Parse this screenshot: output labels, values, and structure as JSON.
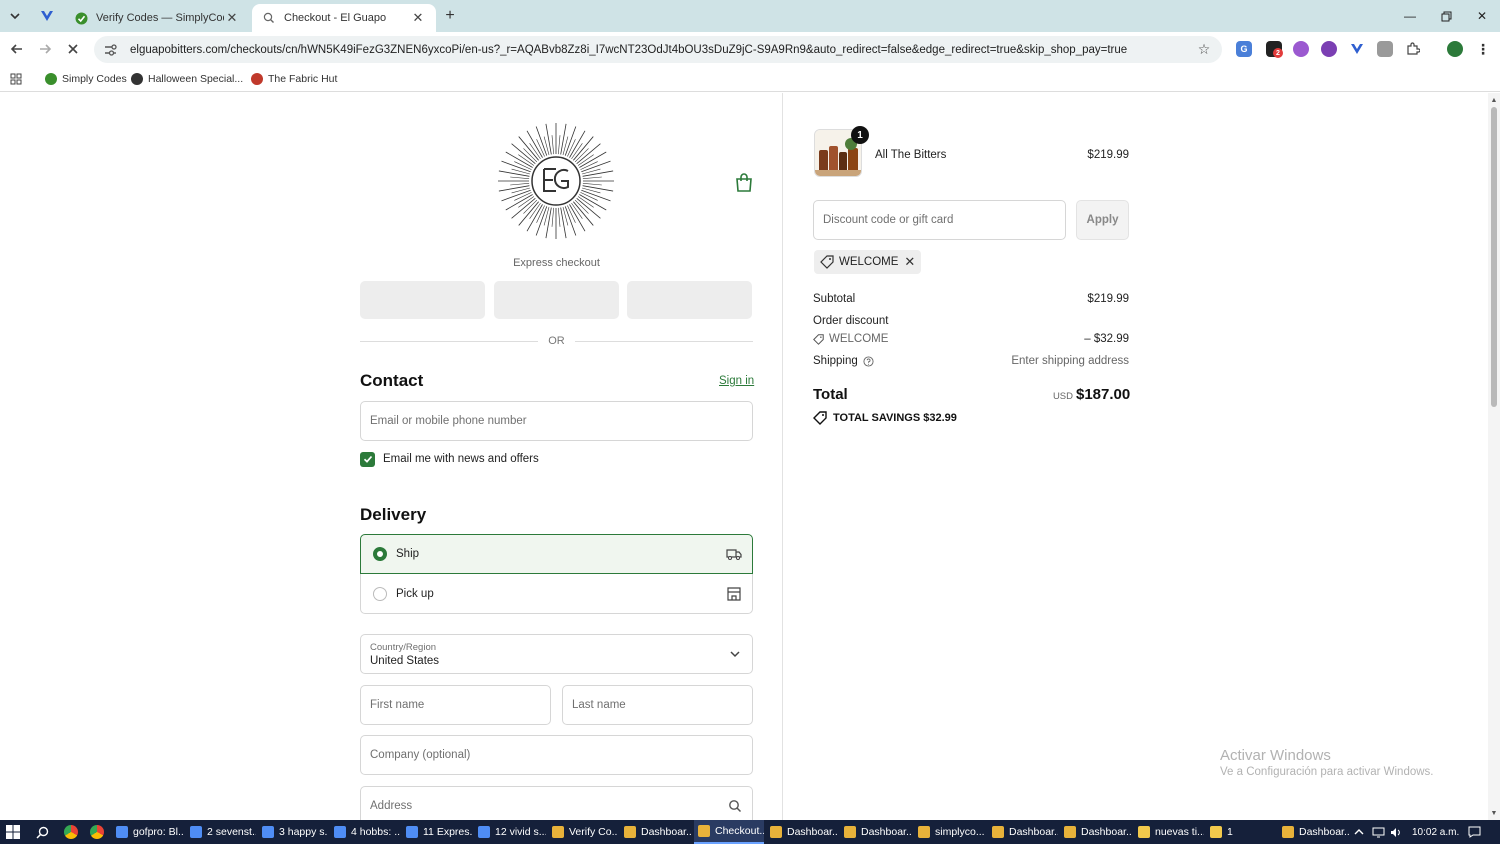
{
  "browser": {
    "tabs": [
      {
        "title": "Verify Codes — SimplyCodes",
        "active": false,
        "icon": "simplycodes-icon"
      },
      {
        "title": "Checkout - El Guapo",
        "active": true,
        "icon": "shop-icon"
      }
    ],
    "url": "elguapobitters.com/checkouts/cn/hWN5K49iFezG3ZNEN6yxcoPi/en-us?_r=AQABvb8Zz8i_I7wcNT23OdJt4bOU3sDuZ9jC-S9A9Rn9&auto_redirect=false&edge_redirect=true&skip_shop_pay=true",
    "bookmarks": [
      "Simply Codes",
      "Halloween Special...",
      "The Fabric Hut"
    ],
    "extension_badge": "2"
  },
  "checkout": {
    "express_label": "Express checkout",
    "or_label": "OR",
    "contact": {
      "heading": "Contact",
      "sign_in": "Sign in",
      "email_placeholder": "Email or mobile phone number",
      "newsletter_label": "Email me with news and offers",
      "newsletter_checked": true
    },
    "delivery": {
      "heading": "Delivery",
      "options": [
        {
          "label": "Ship",
          "selected": true,
          "icon": "truck-icon"
        },
        {
          "label": "Pick up",
          "selected": false,
          "icon": "store-icon"
        }
      ],
      "country_label": "Country/Region",
      "country_value": "United States",
      "first_name_placeholder": "First name",
      "last_name_placeholder": "Last name",
      "company_placeholder": "Company (optional)",
      "address_placeholder": "Address"
    }
  },
  "summary": {
    "product": {
      "name": "All The Bitters",
      "price": "$219.99",
      "quantity": "1"
    },
    "discount_placeholder": "Discount code or gift card",
    "apply_label": "Apply",
    "applied_code": "WELCOME",
    "subtotal_label": "Subtotal",
    "subtotal_value": "$219.99",
    "order_discount_label": "Order discount",
    "discount_code": "WELCOME",
    "discount_value": "– $32.99",
    "shipping_label": "Shipping",
    "shipping_value": "Enter shipping address",
    "total_label": "Total",
    "total_currency": "USD",
    "total_value": "$187.00",
    "savings_label": "TOTAL SAVINGS",
    "savings_value": "$32.99"
  },
  "watermark": {
    "line1": "Activar Windows",
    "line2": "Ve a Configuración para activar Windows."
  },
  "taskbar": {
    "items": [
      {
        "label": "gofpro: Bl...",
        "color": "#4f8df5",
        "active": false
      },
      {
        "label": "2 sevenst...",
        "color": "#4f8df5",
        "active": false
      },
      {
        "label": "3 happy s...",
        "color": "#4f8df5",
        "active": false
      },
      {
        "label": "4 hobbs: ...",
        "color": "#4f8df5",
        "active": false
      },
      {
        "label": "11 Expres...",
        "color": "#4f8df5",
        "active": false
      },
      {
        "label": "12 vivid s...",
        "color": "#4f8df5",
        "active": false
      },
      {
        "label": "Verify Co...",
        "color": "#e8b23a",
        "active": false
      },
      {
        "label": "Dashboar...",
        "color": "#e8b23a",
        "active": false
      },
      {
        "label": "Checkout...",
        "color": "#e8b23a",
        "active": true
      },
      {
        "label": "Dashboar...",
        "color": "#e8b23a",
        "active": false
      },
      {
        "label": "Dashboar...",
        "color": "#e8b23a",
        "active": false
      },
      {
        "label": "simplyco...",
        "color": "#e8b23a",
        "active": false
      },
      {
        "label": "Dashboar...",
        "color": "#e8b23a",
        "active": false
      },
      {
        "label": "Dashboar...",
        "color": "#e8b23a",
        "active": false
      },
      {
        "label": "nuevas ti...",
        "color": "#f2c94c",
        "active": false
      },
      {
        "label": "1",
        "color": "#f2c94c",
        "active": false
      },
      {
        "label": "Dashboar...",
        "color": "#e8b23a",
        "active": false
      }
    ],
    "time": "10:02 a.m."
  },
  "colors": {
    "accent": "#2c7a3a",
    "taskbar": "#15203a",
    "tabbar": "#cfe3e6"
  }
}
